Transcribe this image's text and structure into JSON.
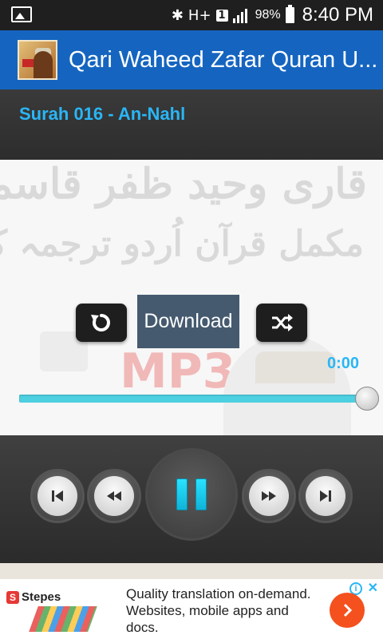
{
  "status_bar": {
    "battery": "98%",
    "time": "8:40 PM",
    "sim_label": "1",
    "network_label": "H+"
  },
  "app_bar": {
    "title": "Qari Waheed Zafar Quran U..."
  },
  "player": {
    "surah_title": "Surah 016 - An-Nahl",
    "download_label": "Download",
    "elapsed": "0:00",
    "progress": 1.0
  },
  "banner": {
    "urdu_line1": "قاری وحید ظفر قاسمی",
    "urdu_line2": "مکمل قرآن اُردو ترجمہ کے ساتھ",
    "mp3_mark": "MP3"
  },
  "ad": {
    "brand": "Stepes",
    "brand_initial": "S",
    "text": "Quality translation on-demand. Websites, mobile apps and docs."
  },
  "colors": {
    "action_bar": "#1565c0",
    "accent": "#29b6f6",
    "download_bg": "#455a6f"
  }
}
